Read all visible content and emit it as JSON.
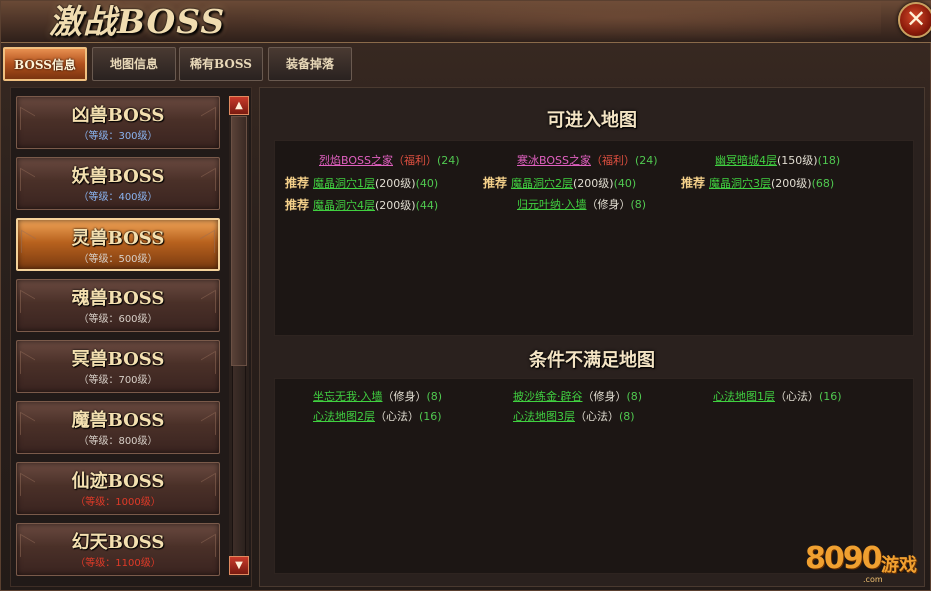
{
  "window": {
    "title": "激战BOSS",
    "close_glyph": "✕"
  },
  "tabs": [
    {
      "label": "BOSS信息",
      "active": true
    },
    {
      "label": "地图信息",
      "active": false
    },
    {
      "label": "稀有BOSS",
      "active": false
    },
    {
      "label": "装备掉落",
      "active": false
    }
  ],
  "bosses": [
    {
      "name": "凶兽BOSS",
      "level": "（等级：300级）",
      "level_color": "blue"
    },
    {
      "name": "妖兽BOSS",
      "level": "（等级：400级）",
      "level_color": "blue"
    },
    {
      "name": "灵兽BOSS",
      "level": "（等级：500级）",
      "level_color": "gray",
      "active": true
    },
    {
      "name": "魂兽BOSS",
      "level": "（等级：600级）",
      "level_color": "gray"
    },
    {
      "name": "冥兽BOSS",
      "level": "（等级：700级）",
      "level_color": "gray"
    },
    {
      "name": "魔兽BOSS",
      "level": "（等级：800级）",
      "level_color": "gray"
    },
    {
      "name": "仙迹BOSS",
      "level": "（等级：1000级）",
      "level_color": "red"
    },
    {
      "name": "幻天BOSS",
      "level": "（等级：1100级）",
      "level_color": "red"
    }
  ],
  "scroll": {
    "up_glyph": "▲",
    "down_glyph": "▼"
  },
  "accessible": {
    "title": "可进入地图",
    "recommend_label": "推荐",
    "entries": [
      {
        "name": "烈焰BOSS之家",
        "color": "pink",
        "suffix": "（福利）",
        "suffix_color": "red",
        "count": "(24)",
        "recommend": false
      },
      {
        "name": "寒冰BOSS之家",
        "color": "pink",
        "suffix": "（福利）",
        "suffix_color": "red",
        "count": "(24)",
        "recommend": false
      },
      {
        "name": "幽冥暗城4层",
        "color": "green",
        "suffix": "(150级)",
        "suffix_color": "white",
        "count": "(18)",
        "recommend": false
      },
      {
        "name": "魔晶洞穴1层",
        "color": "green",
        "suffix": "(200级)",
        "suffix_color": "white",
        "count": "(40)",
        "recommend": true
      },
      {
        "name": "魔晶洞穴2层",
        "color": "green",
        "suffix": "(200级)",
        "suffix_color": "white",
        "count": "(40)",
        "recommend": true
      },
      {
        "name": "魔晶洞穴3层",
        "color": "green",
        "suffix": "(200级)",
        "suffix_color": "white",
        "count": "(68)",
        "recommend": true
      },
      {
        "name": "魔晶洞穴4层",
        "color": "green",
        "suffix": "(200级)",
        "suffix_color": "white",
        "count": "(44)",
        "recommend": true
      },
      {
        "name": "归元叶纳·入墙",
        "color": "green",
        "suffix": "（修身）",
        "suffix_color": "white",
        "count": "(8)",
        "recommend": false
      }
    ]
  },
  "unavailable": {
    "title": "条件不满足地图",
    "entries": [
      {
        "name": "坐忘无我·入墙",
        "suffix": "（修身）",
        "count": "(8)"
      },
      {
        "name": "披沙练金·辟谷",
        "suffix": "（修身）",
        "count": "(8)"
      },
      {
        "name": "心法地图1层",
        "suffix": "（心法）",
        "count": "(16)"
      },
      {
        "name": "心法地图2层",
        "suffix": "（心法）",
        "count": "(16)"
      },
      {
        "name": "心法地图3层",
        "suffix": "（心法）",
        "count": "(8)"
      }
    ]
  },
  "logo": {
    "number": "8090",
    "cn": "游戏",
    "domain": ".com"
  }
}
